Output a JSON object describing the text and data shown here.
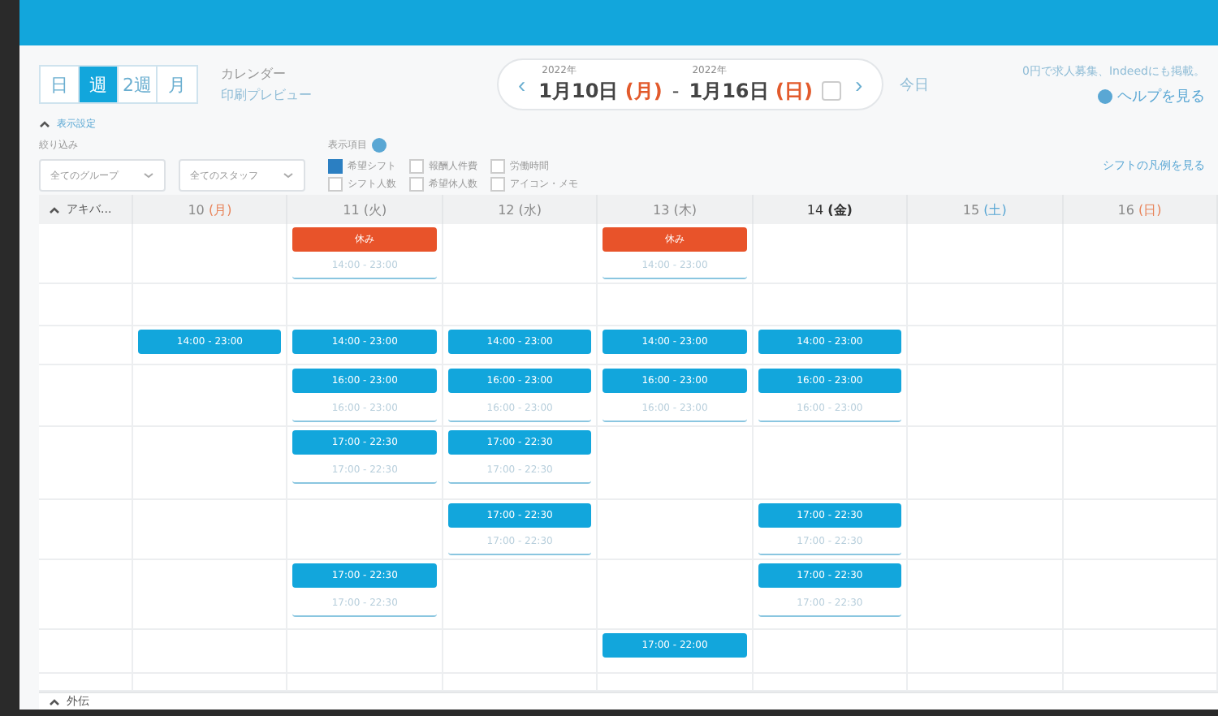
{
  "view_tabs": [
    {
      "label": "日",
      "selected": false
    },
    {
      "label": "週",
      "selected": true
    },
    {
      "label": "2週",
      "selected": false
    },
    {
      "label": "月",
      "selected": false
    }
  ],
  "links": [
    "カレンダー",
    "印刷プレビュー"
  ],
  "date_nav": {
    "prev": "‹",
    "start_year": "2022年",
    "start": "1月10日",
    "start_dow": "(月)",
    "sep": "-",
    "end_year": "2022年",
    "end": "1月16日",
    "end_dow": "(日)",
    "next": "›",
    "today": "今日"
  },
  "notice": "0円で求人募集、Indeedにも掲載。",
  "help": "ヘルプを見る",
  "settings_toggle": "表示設定",
  "filter": {
    "label": "絞り込み",
    "selects": [
      "全てのグループ",
      "全てのスタッフ"
    ]
  },
  "display_items": {
    "label": "表示項目",
    "options": [
      {
        "label": "希望シフト",
        "checked": true
      },
      {
        "label": "報酬人件費",
        "checked": false
      },
      {
        "label": "労働時間",
        "checked": false
      },
      {
        "label": "シフト人数",
        "checked": false
      },
      {
        "label": "希望休人数",
        "checked": false
      },
      {
        "label": "アイコン・メモ",
        "checked": false
      }
    ]
  },
  "legend_link": "シフトの凡例を見る",
  "group": {
    "name": "アキバ...",
    "footer": "外伝"
  },
  "days": [
    {
      "num": "10",
      "dow": "(月)",
      "kind": "holiday"
    },
    {
      "num": "11",
      "dow": "(火)",
      "kind": "weekday"
    },
    {
      "num": "12",
      "dow": "(水)",
      "kind": "weekday"
    },
    {
      "num": "13",
      "dow": "(木)",
      "kind": "weekday"
    },
    {
      "num": "14",
      "dow": "(金)",
      "kind": "today"
    },
    {
      "num": "15",
      "dow": "(土)",
      "kind": "saturday"
    },
    {
      "num": "16",
      "dow": "(日)",
      "kind": "holiday"
    }
  ],
  "rows": [
    {
      "cells": [
        [],
        [
          {
            "kind": "off",
            "text": "休み"
          },
          {
            "kind": "wish",
            "text": "14:00 - 23:00"
          }
        ],
        [],
        [
          {
            "kind": "off",
            "text": "休み"
          },
          {
            "kind": "wish",
            "text": "14:00 - 23:00"
          }
        ],
        [],
        [],
        []
      ]
    },
    {
      "cells": [
        [],
        [],
        [],
        [],
        [],
        [],
        []
      ]
    },
    {
      "cells": [
        [
          {
            "kind": "shift",
            "text": "14:00 - 23:00"
          }
        ],
        [
          {
            "kind": "shift",
            "text": "14:00 - 23:00"
          }
        ],
        [
          {
            "kind": "shift",
            "text": "14:00 - 23:00"
          }
        ],
        [
          {
            "kind": "shift",
            "text": "14:00 - 23:00"
          }
        ],
        [
          {
            "kind": "shift",
            "text": "14:00 - 23:00"
          }
        ],
        [],
        []
      ]
    },
    {
      "cells": [
        [],
        [
          {
            "kind": "shift",
            "text": "16:00 - 23:00"
          },
          {
            "kind": "wish",
            "text": "16:00 - 23:00"
          }
        ],
        [
          {
            "kind": "shift",
            "text": "16:00 - 23:00"
          },
          {
            "kind": "wish",
            "text": "16:00 - 23:00"
          }
        ],
        [
          {
            "kind": "shift",
            "text": "16:00 - 23:00"
          },
          {
            "kind": "wish",
            "text": "16:00 - 23:00"
          }
        ],
        [
          {
            "kind": "shift",
            "text": "16:00 - 23:00"
          },
          {
            "kind": "wish",
            "text": "16:00 - 23:00"
          }
        ],
        [],
        []
      ]
    },
    {
      "cells": [
        [],
        [
          {
            "kind": "shift",
            "text": "17:00 - 22:30"
          },
          {
            "kind": "wish",
            "text": "17:00 - 22:30"
          }
        ],
        [
          {
            "kind": "shift",
            "text": "17:00 - 22:30"
          },
          {
            "kind": "wish",
            "text": "17:00 - 22:30"
          }
        ],
        [],
        [],
        [],
        []
      ]
    },
    {
      "cells": [
        [],
        [],
        [
          {
            "kind": "shift",
            "text": "17:00 - 22:30"
          },
          {
            "kind": "wish",
            "text": "17:00 - 22:30"
          }
        ],
        [],
        [
          {
            "kind": "shift",
            "text": "17:00 - 22:30"
          },
          {
            "kind": "wish",
            "text": "17:00 - 22:30"
          }
        ],
        [],
        []
      ]
    },
    {
      "cells": [
        [],
        [
          {
            "kind": "shift",
            "text": "17:00 - 22:30"
          },
          {
            "kind": "wish",
            "text": "17:00 - 22:30"
          }
        ],
        [],
        [],
        [
          {
            "kind": "shift",
            "text": "17:00 - 22:30"
          },
          {
            "kind": "wish",
            "text": "17:00 - 22:30"
          }
        ],
        [],
        []
      ]
    },
    {
      "cells": [
        [],
        [],
        [],
        [
          {
            "kind": "shift",
            "text": "17:00 - 22:00"
          }
        ],
        [],
        [],
        []
      ]
    }
  ]
}
